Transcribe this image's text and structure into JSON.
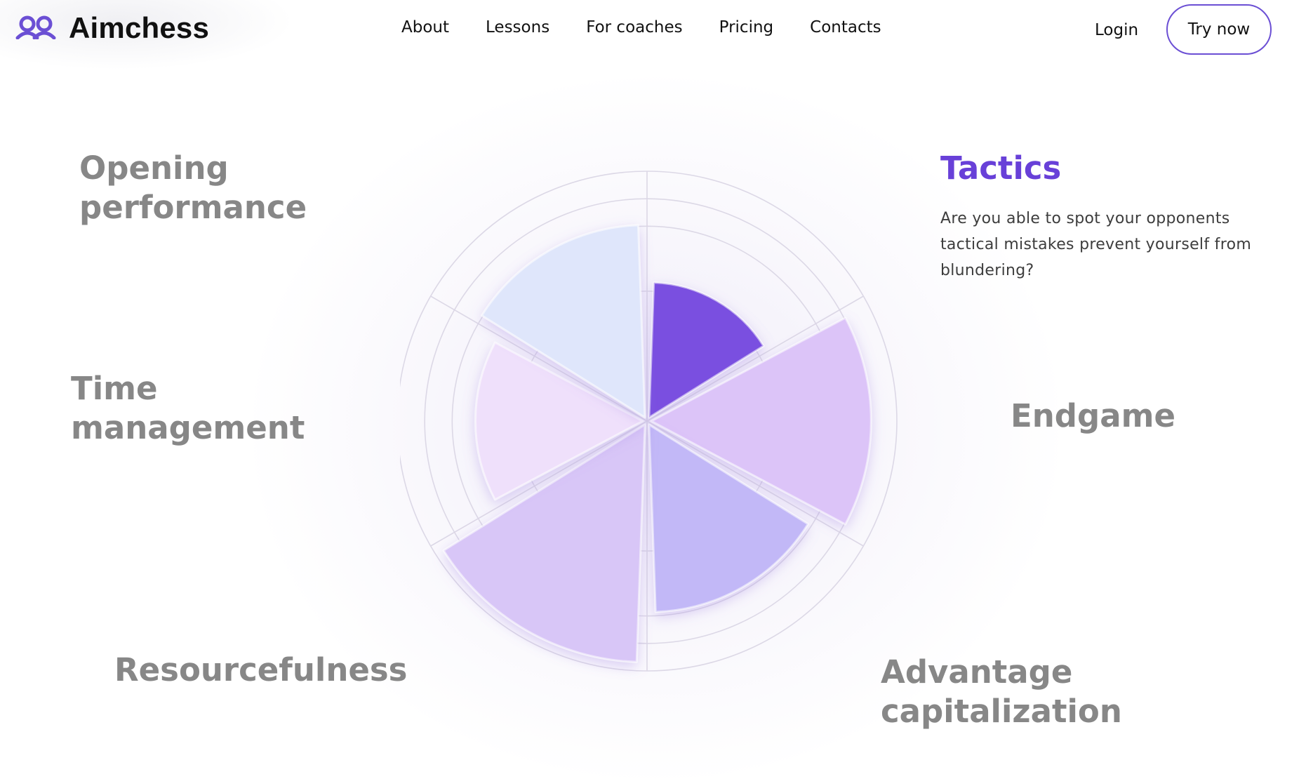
{
  "brand": {
    "name": "Aimchess",
    "logo_icon": "people-pair-icon"
  },
  "nav": {
    "items": [
      {
        "label": "About"
      },
      {
        "label": "Lessons"
      },
      {
        "label": "For coaches"
      },
      {
        "label": "Pricing"
      },
      {
        "label": "Contacts"
      }
    ],
    "login": "Login",
    "cta": "Try now"
  },
  "categories": [
    {
      "label": "Opening performance",
      "active": false
    },
    {
      "label": "Tactics",
      "active": true
    },
    {
      "label": "Endgame",
      "active": false
    },
    {
      "label": "Advantage capitalization",
      "active": false
    },
    {
      "label": "Resourcefulness",
      "active": false
    },
    {
      "label": "Time management",
      "active": false
    }
  ],
  "selected": {
    "title": "Tactics",
    "description": "Are you able to spot your opponents tactical mistakes prevent yourself from blundering?"
  },
  "chart_data": {
    "type": "radar",
    "axes": [
      "Tactics",
      "Endgame",
      "Advantage capitalization",
      "Resourcefulness",
      "Time management",
      "Opening performance"
    ],
    "values": [
      0.54,
      0.88,
      0.75,
      0.95,
      0.67,
      0.77
    ],
    "scale_max": 1,
    "ring_levels": [
      0.52,
      0.78,
      0.89,
      1.0
    ],
    "colors": {
      "Tactics": "#7a4fe0",
      "Endgame": "#dcc4f8",
      "Advantage capitalization": "#c2b8f7",
      "Resourcefulness": "#d8c6f7",
      "Time management": "#efe0fb",
      "Opening performance": "#dfe6fb"
    },
    "accent": "#6840d8"
  }
}
